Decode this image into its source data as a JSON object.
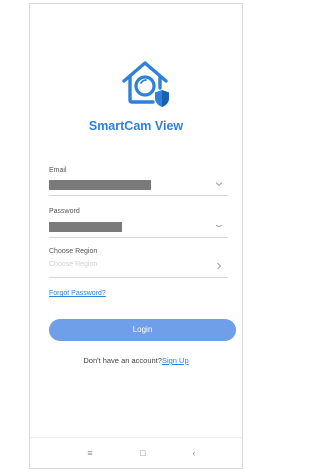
{
  "app": {
    "name": "SmartCam View",
    "brand_color": "#2d82d8"
  },
  "login_form": {
    "email_label": "Email",
    "email_value_masked": true,
    "password_label": "Password",
    "password_value_masked": true,
    "region_label": "Choose Region",
    "region_placeholder": "Choose Region",
    "forgot_password_label": "Forgot Password?",
    "login_button_label": "Login",
    "login_button_color": "#6f9fe8",
    "signup_prompt": "Don't have an account?",
    "signup_link_label": "Sign Up"
  },
  "icons": {
    "logo": "house-camera-shield-icon",
    "email_field": "chevron-down-icon",
    "password_field": "eye-closed-icon",
    "region_field": "chevron-right-icon",
    "nav_menu": "menu-icon",
    "nav_home": "home-square-icon",
    "nav_back": "back-chevron-icon"
  },
  "nav_bar": {
    "menu_glyph": "≡",
    "home_glyph": "□",
    "back_glyph": "‹"
  }
}
